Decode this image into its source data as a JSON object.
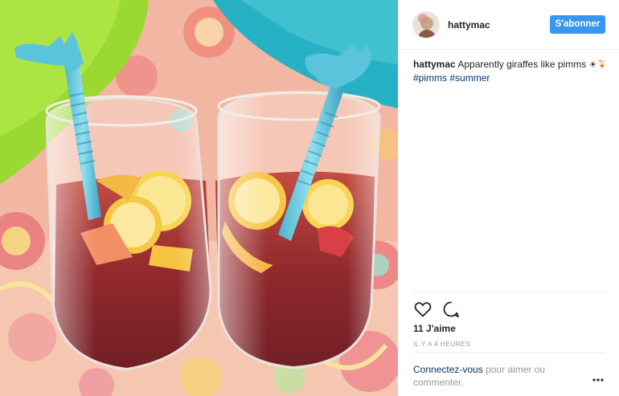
{
  "post": {
    "photo_alt": "Two glasses of pimms with giraffe straws",
    "colors": {
      "accent": "#3897f0",
      "hashtag": "#003569",
      "muted": "#999999",
      "text": "#262626"
    }
  },
  "header": {
    "username": "hattymac",
    "follow_label": "S'abonner"
  },
  "caption": {
    "username": "hattymac",
    "text": "Apparently giraffes like pimms",
    "emoji": "☀🍹",
    "hashtags": [
      "#pimms",
      "#summer"
    ]
  },
  "actions": {
    "like_icon": "heart-icon",
    "comment_icon": "comment-bubble-icon",
    "likes_text": "11 J'aime",
    "timestamp": "IL Y A 4 HEURES"
  },
  "footer": {
    "login_link": "Connectez-vous",
    "login_rest": "pour aimer ou commenter.",
    "more_icon": "more-options-icon"
  }
}
